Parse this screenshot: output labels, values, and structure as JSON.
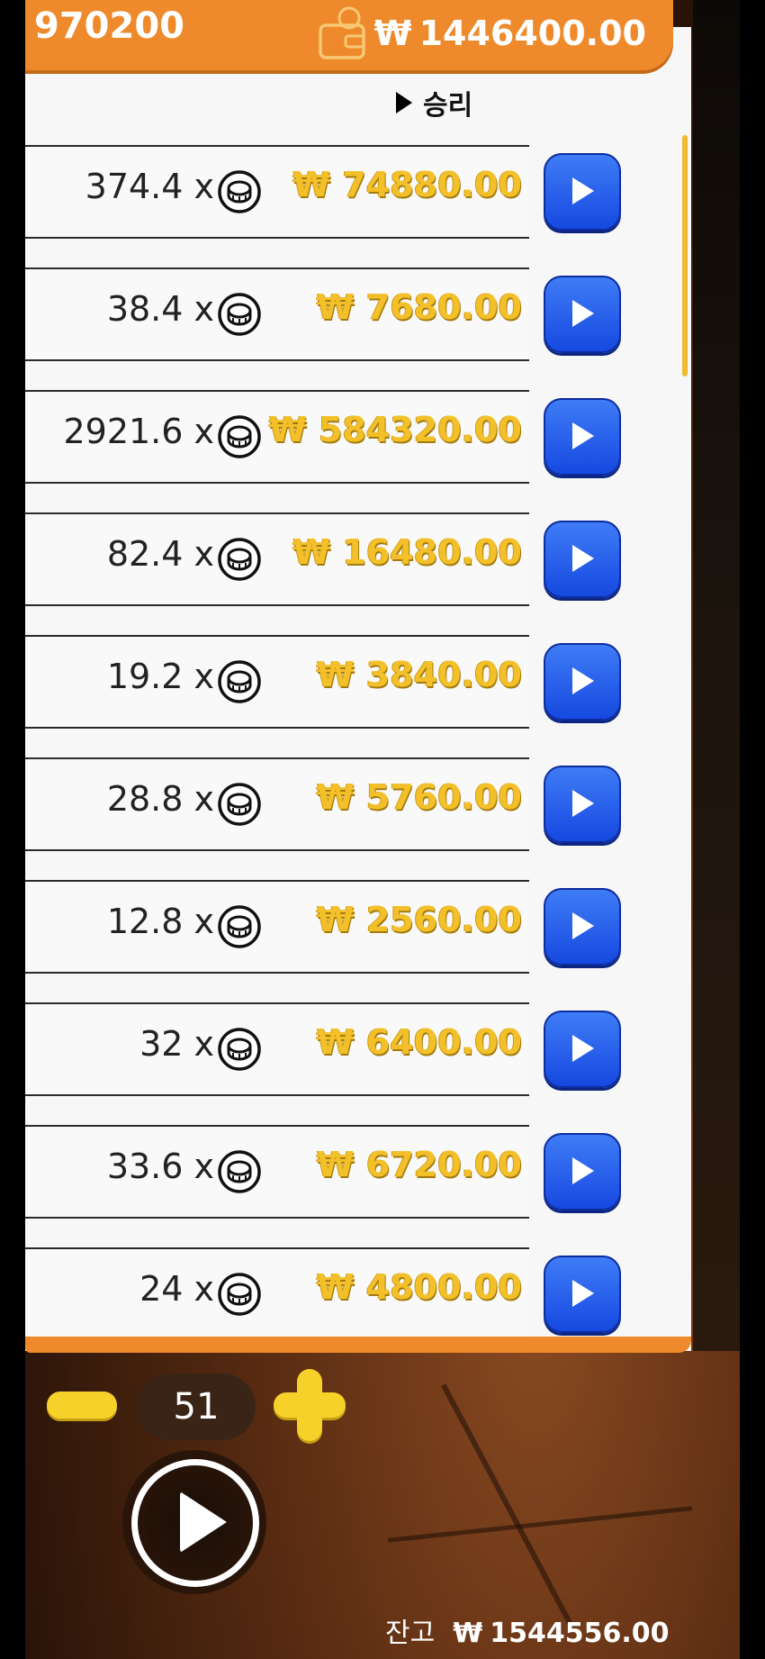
{
  "header": {
    "left_value": "970200",
    "currency": "₩",
    "wallet_value": "1446400.00",
    "wallet_icon": "wallet-icon"
  },
  "table": {
    "column_header": "승리",
    "rows": [
      {
        "multiplier": "374.4 x",
        "win": "₩ 74880.00"
      },
      {
        "multiplier": "38.4 x",
        "win": "₩ 7680.00"
      },
      {
        "multiplier": "2921.6 x",
        "win": "₩ 584320.00"
      },
      {
        "multiplier": "82.4 x",
        "win": "₩ 16480.00"
      },
      {
        "multiplier": "19.2 x",
        "win": "₩ 3840.00"
      },
      {
        "multiplier": "28.8 x",
        "win": "₩ 5760.00"
      },
      {
        "multiplier": "12.8 x",
        "win": "₩ 2560.00"
      },
      {
        "multiplier": "32 x",
        "win": "₩ 6400.00"
      },
      {
        "multiplier": "33.6 x",
        "win": "₩ 6720.00"
      },
      {
        "multiplier": "24 x",
        "win": "₩ 4800.00"
      }
    ]
  },
  "controls": {
    "counter": "51"
  },
  "balance": {
    "label": "잔고",
    "currency": "₩",
    "value": "1544556.00"
  },
  "colors": {
    "header_orange": "#ef8a2c",
    "win_gold": "#f4c02a",
    "play_blue": "#1649e0",
    "control_yellow": "#f6d129"
  }
}
